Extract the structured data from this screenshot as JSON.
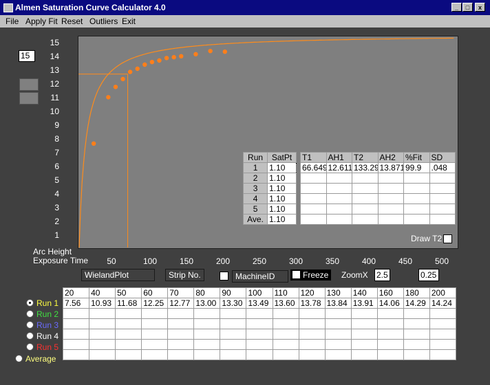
{
  "window": {
    "title": "Almen Saturation Curve Calculator  4.0",
    "minimize": "_",
    "maximize": "□",
    "close": "x"
  },
  "menu": [
    "File",
    "Apply Fit",
    "Reset",
    "Outliers",
    "Exit"
  ],
  "sat_input_value": "15",
  "axis": {
    "y_label": "Arc Height",
    "x_label": "Exposure Time",
    "y_ticks": [
      "15",
      "14",
      "13",
      "12",
      "11",
      "10",
      "9",
      "8",
      "7",
      "6",
      "5",
      "4",
      "3",
      "2",
      "1"
    ],
    "x_ticks": [
      "50",
      "100",
      "150",
      "200",
      "250",
      "300",
      "350",
      "400",
      "450",
      "500"
    ]
  },
  "chart_data": {
    "type": "scatter",
    "xlim": [
      0,
      520
    ],
    "ylim": [
      0,
      15
    ],
    "points": [
      {
        "x": 20,
        "y": 7.56
      },
      {
        "x": 40,
        "y": 10.93
      },
      {
        "x": 50,
        "y": 11.68
      },
      {
        "x": 60,
        "y": 12.25
      },
      {
        "x": 70,
        "y": 12.77
      },
      {
        "x": 80,
        "y": 13.0
      },
      {
        "x": 90,
        "y": 13.3
      },
      {
        "x": 100,
        "y": 13.49
      },
      {
        "x": 110,
        "y": 13.6
      },
      {
        "x": 120,
        "y": 13.78
      },
      {
        "x": 130,
        "y": 13.84
      },
      {
        "x": 140,
        "y": 13.91
      },
      {
        "x": 160,
        "y": 14.06
      },
      {
        "x": 180,
        "y": 14.29
      },
      {
        "x": 200,
        "y": 14.24
      }
    ],
    "fit_curve": {
      "a": 15.5,
      "b": 9.2
    },
    "crosshair": {
      "x": 66.649,
      "y": 12.611
    },
    "colors": {
      "curve": "#ff8c1a",
      "points": "#ff7f1a",
      "background": "#7f7f7f"
    }
  },
  "satpt_table": {
    "headers": [
      "Run",
      "SatPt"
    ],
    "rows": [
      [
        "1",
        "1.10"
      ],
      [
        "2",
        "1.10"
      ],
      [
        "3",
        "1.10"
      ],
      [
        "4",
        "1.10"
      ],
      [
        "5",
        "1.10"
      ],
      [
        "Ave.",
        "1.10"
      ]
    ]
  },
  "fit_table": {
    "headers": [
      "T1",
      "AH1",
      "T2",
      "AH2",
      "%Fit",
      "SD"
    ],
    "row1": [
      "66.649",
      "12.611",
      "133.29",
      "13.871",
      "99.9",
      ".048"
    ]
  },
  "draw_t2_label": "Draw T2",
  "fields": {
    "plot_name": "WielandPlot",
    "strip_no": "Strip No.",
    "machine_id": "MachineID",
    "freeze_label": "Freeze",
    "zoomx_label": "ZoomX",
    "zoomx_value": "2.5",
    "zoom_value2": "0.25"
  },
  "runs": [
    {
      "label": "Run 1",
      "color": "#ffff40",
      "selected": true
    },
    {
      "label": "Run 2",
      "color": "#40e040",
      "selected": false
    },
    {
      "label": "Run 3",
      "color": "#6a6aff",
      "selected": false
    },
    {
      "label": "Run 4",
      "color": "#ffffff",
      "selected": false
    },
    {
      "label": "Run 5",
      "color": "#ff3030",
      "selected": false
    }
  ],
  "average_label": "Average",
  "average_color": "#ffff80",
  "data_grid": {
    "times": [
      "20",
      "40",
      "50",
      "60",
      "70",
      "80",
      "90",
      "100",
      "110",
      "120",
      "130",
      "140",
      "160",
      "180",
      "200"
    ],
    "run1": [
      "7.56",
      "10.93",
      "11.68",
      "12.25",
      "12.77",
      "13.00",
      "13.30",
      "13.49",
      "13.60",
      "13.78",
      "13.84",
      "13.91",
      "14.06",
      "14.29",
      "14.24"
    ]
  }
}
